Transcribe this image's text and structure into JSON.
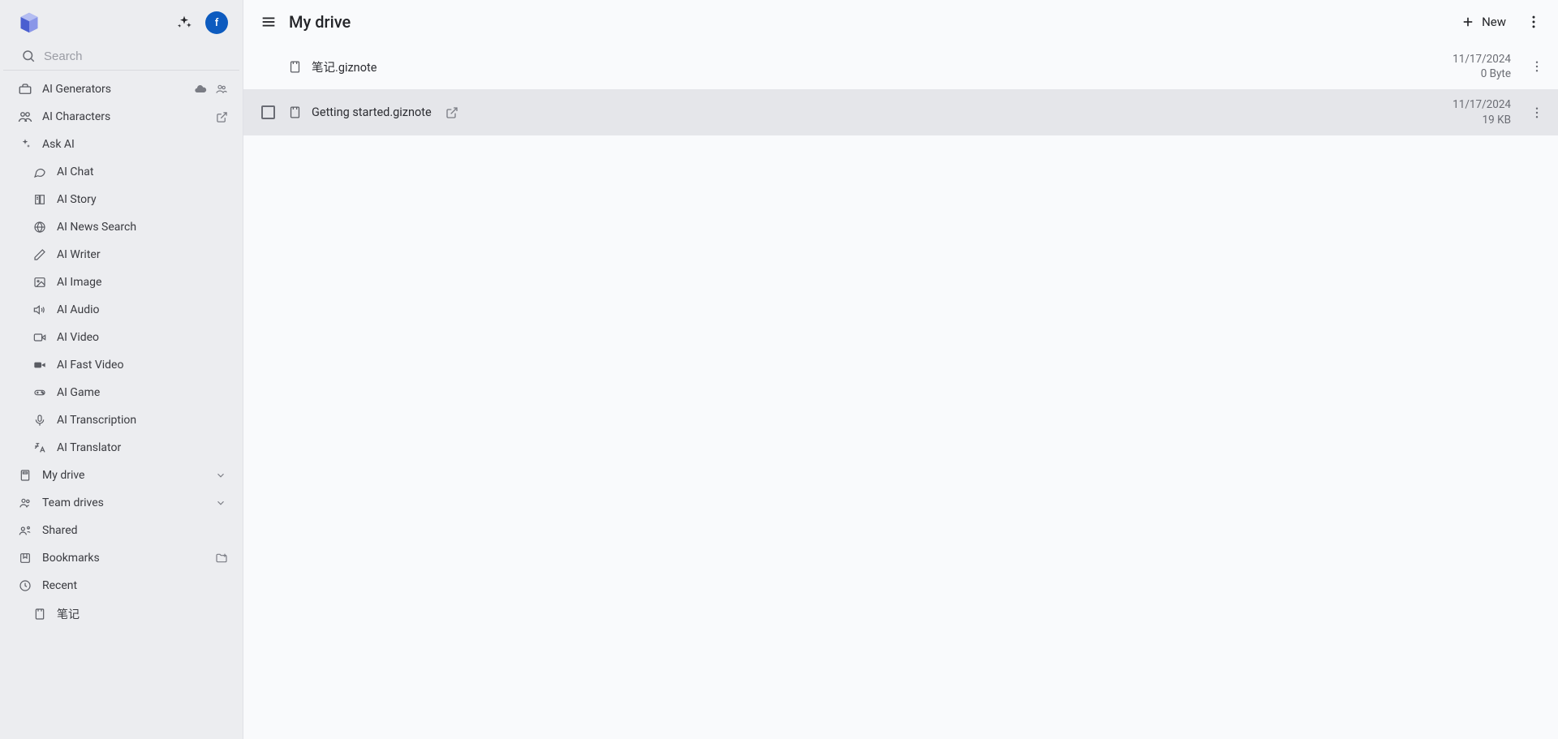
{
  "header": {
    "avatar_letter": "f"
  },
  "search": {
    "placeholder": "Search"
  },
  "sidebar": {
    "items": [
      {
        "label": "AI Generators",
        "trailing": [
          "cloud",
          "group"
        ]
      },
      {
        "label": "AI Characters",
        "trailing": [
          "open-ext"
        ]
      },
      {
        "label": "Ask AI"
      }
    ],
    "ai_sub": [
      {
        "label": "AI Chat"
      },
      {
        "label": "AI Story"
      },
      {
        "label": "AI News Search"
      },
      {
        "label": "AI Writer"
      },
      {
        "label": "AI Image"
      },
      {
        "label": "AI Audio"
      },
      {
        "label": "AI Video"
      },
      {
        "label": "AI Fast Video"
      },
      {
        "label": "AI Game"
      },
      {
        "label": "AI Transcription"
      },
      {
        "label": "AI Translator"
      }
    ],
    "sections": [
      {
        "label": "My drive",
        "expandable": true
      },
      {
        "label": "Team drives",
        "expandable": true
      },
      {
        "label": "Shared"
      },
      {
        "label": "Bookmarks",
        "trailing": [
          "new-folder"
        ]
      },
      {
        "label": "Recent"
      }
    ],
    "recent_items": [
      {
        "label": "笔记"
      }
    ]
  },
  "main": {
    "title": "My drive",
    "new_label": "New",
    "files": [
      {
        "name": "笔记.giznote",
        "date": "11/17/2024",
        "size": "0 Byte",
        "hovered": false
      },
      {
        "name": "Getting started.giznote",
        "date": "11/17/2024",
        "size": "19 KB",
        "hovered": true,
        "show_open": true
      }
    ]
  }
}
